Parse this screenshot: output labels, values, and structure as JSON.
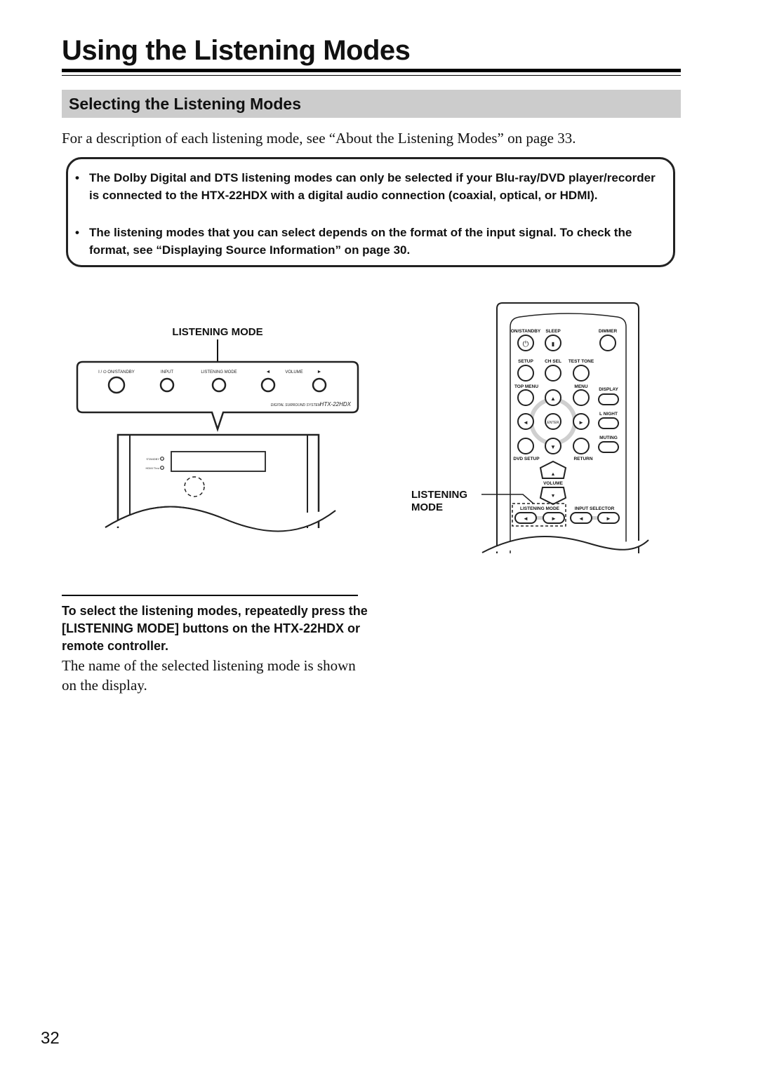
{
  "page": {
    "title": "Using the Listening Modes",
    "section_title": "Selecting the Listening Modes",
    "intro": "For a description of each listening mode, see “About the Listening Modes” on page 33.",
    "page_number": "32"
  },
  "notes": {
    "bullet": "•",
    "items": [
      "The Dolby Digital and DTS listening modes can only be selected if your Blu-ray/DVD player/recorder is connected to the HTX-22HDX with a digital audio connection (coaxial, optical, or HDMI).",
      "The listening modes that you can select depends on the format of the input signal. To check the format, see “Displaying Source Information” on page 30."
    ]
  },
  "front_panel": {
    "callout_label": "LISTENING MODE",
    "buttons": {
      "on_standby": "I / ⏻ ON/STANDBY",
      "input": "INPUT",
      "listening_mode": "LISTENING MODE",
      "vol_down": "◄",
      "volume": "VOLUME",
      "vol_up": "►"
    },
    "model_caption": "DIGITAL SURROUND SYSTEM",
    "model_name": "HTX-22HDX",
    "indicators": [
      "STANDBY",
      "HDMI Thru"
    ]
  },
  "remote": {
    "callout_label_line1": "LISTENING",
    "callout_label_line2": "MODE",
    "labels": {
      "on_standby": "ON/STANDBY",
      "sleep": "SLEEP",
      "dimmer": "DIMMER",
      "setup": "SETUP",
      "ch_sel": "CH SEL",
      "test_tone": "TEST TONE",
      "top_menu": "TOP MENU",
      "menu": "MENU",
      "display": "DISPLAY",
      "l_night": "L NIGHT",
      "muting": "MUTING",
      "enter": "ENTER",
      "dvd_setup": "DVD SETUP",
      "return": "RETURN",
      "volume": "VOLUME",
      "listening_mode": "LISTENING MODE",
      "input_selector": "INPUT SELECTOR"
    },
    "glyphs": {
      "power": "⏻",
      "sleep": "▮",
      "up": "▲",
      "down": "▼",
      "left": "◄",
      "right": "►"
    }
  },
  "step": {
    "instruction": "To select the listening modes, repeatedly press the [LISTENING MODE] buttons on the HTX-22HDX or remote controller.",
    "result": "The name of the selected listening mode is shown on the display."
  }
}
